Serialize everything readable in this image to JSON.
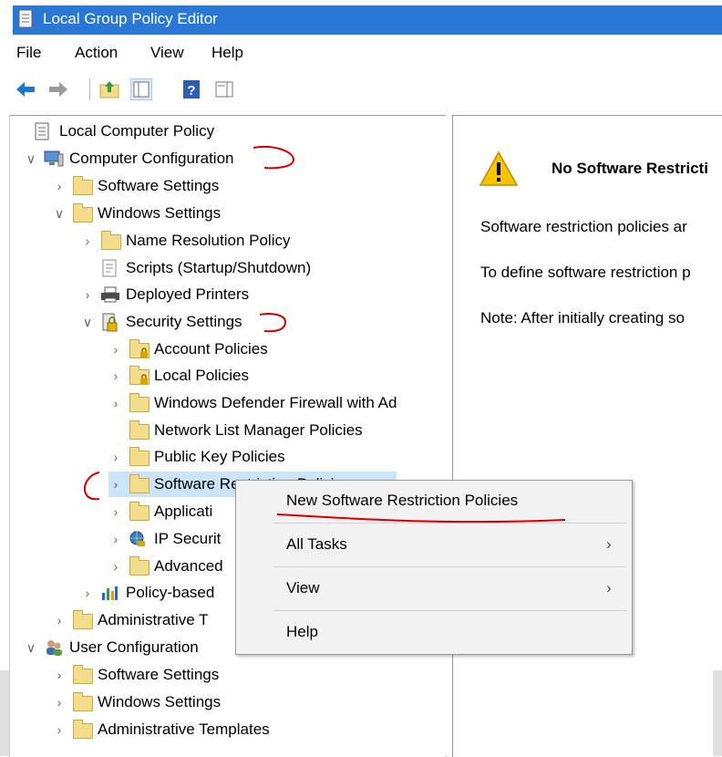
{
  "window": {
    "title": "Local Group Policy Editor"
  },
  "menu": [
    "File",
    "Action",
    "View",
    "Help"
  ],
  "tree": [
    {
      "label": "Local Computer Policy",
      "expander": "",
      "icon": "policy-doc-icon"
    },
    {
      "label": "Computer Configuration",
      "expander": "∨",
      "icon": "computer-icon"
    },
    {
      "label": "Software Settings",
      "expander": "›",
      "icon": "folder-icon"
    },
    {
      "label": "Windows Settings",
      "expander": "∨",
      "icon": "folder-icon"
    },
    {
      "label": "Name Resolution Policy",
      "expander": "›",
      "icon": "folder-icon"
    },
    {
      "label": "Scripts (Startup/Shutdown)",
      "expander": "",
      "icon": "script-icon"
    },
    {
      "label": "Deployed Printers",
      "expander": "›",
      "icon": "printer-icon"
    },
    {
      "label": "Security Settings",
      "expander": "∨",
      "icon": "security-icon"
    },
    {
      "label": "Account Policies",
      "expander": "›",
      "icon": "locked-folder-icon"
    },
    {
      "label": "Local Policies",
      "expander": "›",
      "icon": "locked-folder-icon"
    },
    {
      "label": "Windows Defender Firewall with Ad",
      "expander": "›",
      "icon": "folder-icon"
    },
    {
      "label": "Network List Manager Policies",
      "expander": "",
      "icon": "folder-icon"
    },
    {
      "label": "Public Key Policies",
      "expander": "›",
      "icon": "folder-icon"
    },
    {
      "label": "Software Restriction Policies",
      "expander": "›",
      "icon": "folder-icon"
    },
    {
      "label": "Applicati",
      "expander": "›",
      "icon": "folder-icon"
    },
    {
      "label": "IP Securit",
      "expander": "›",
      "icon": "ip-security-icon"
    },
    {
      "label": "Advanced",
      "expander": "›",
      "icon": "folder-icon"
    },
    {
      "label": "Policy-based",
      "expander": "›",
      "icon": "chart-icon"
    },
    {
      "label": "Administrative T",
      "expander": "›",
      "icon": "folder-icon"
    },
    {
      "label": "User Configuration",
      "expander": "∨",
      "icon": "users-icon"
    },
    {
      "label": "Software Settings",
      "expander": "›",
      "icon": "folder-icon"
    },
    {
      "label": "Windows Settings",
      "expander": "›",
      "icon": "folder-icon"
    },
    {
      "label": "Administrative Templates",
      "expander": "›",
      "icon": "folder-icon"
    }
  ],
  "right_pane": {
    "heading": "No Software Restricti",
    "line1": "Software restriction policies ar",
    "line2": "To define software restriction p",
    "line3": "Note: After initially creating so"
  },
  "context_menu": [
    {
      "label": "New Software Restriction Policies",
      "arrow": ""
    },
    {
      "label": "All Tasks",
      "arrow": "›"
    },
    {
      "label": "View",
      "arrow": "›"
    },
    {
      "label": "Help",
      "arrow": ""
    }
  ],
  "colors": {
    "title_bar": "#2a78d6",
    "selection": "#cce4f7",
    "annotation": "#d40000"
  }
}
